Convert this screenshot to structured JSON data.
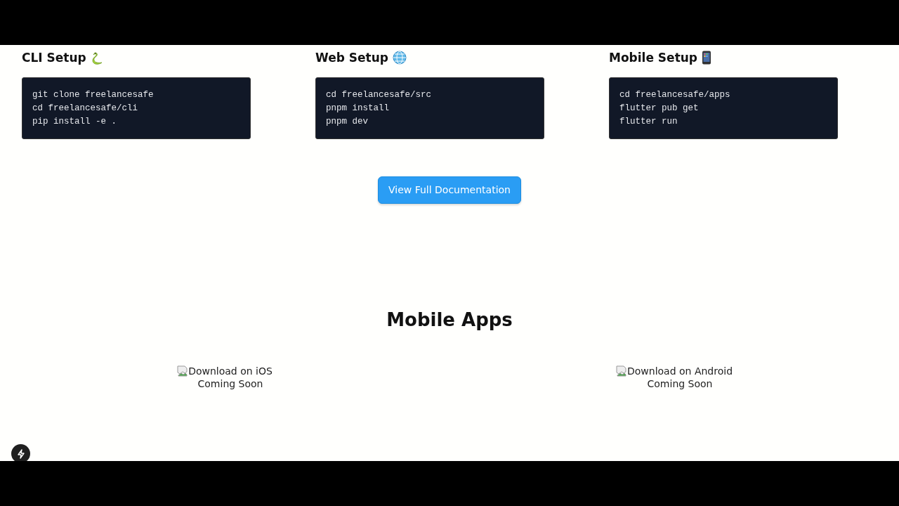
{
  "setup": [
    {
      "kind": "cli",
      "title": "CLI Setup",
      "lines": [
        "git clone freelancesafe",
        "cd freelancesafe/cli",
        "pip install -e ."
      ]
    },
    {
      "kind": "web",
      "title": "Web Setup",
      "lines": [
        "cd freelancesafe/src",
        "pnpm install",
        "pnpm dev"
      ]
    },
    {
      "kind": "mobile",
      "title": "Mobile Setup",
      "lines": [
        "cd freelancesafe/apps",
        "flutter pub get",
        "flutter run"
      ]
    }
  ],
  "docs_button": "View Full Documentation",
  "mobile_apps": {
    "title": "Mobile Apps",
    "apps": [
      {
        "label": "Download on iOS",
        "status": "Coming Soon"
      },
      {
        "label": "Download on Android",
        "status": "Coming Soon"
      }
    ]
  }
}
